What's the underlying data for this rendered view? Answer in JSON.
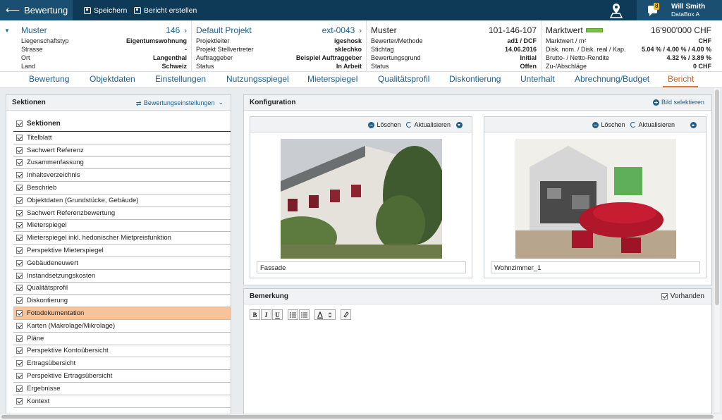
{
  "topbar": {
    "back_title": "Bewertung",
    "save_label": "Speichern",
    "report_label": "Bericht erstellen",
    "notification_count": "8",
    "user_name": "Will Smith",
    "user_sub": "DataBox A"
  },
  "info": {
    "col1": {
      "title": "Muster",
      "id": "146",
      "rows": [
        {
          "k": "Liegenschaftstyp",
          "v": "Eigentumswohnung"
        },
        {
          "k": "Strasse",
          "v": "-"
        },
        {
          "k": "Ort",
          "v": "Langenthal"
        },
        {
          "k": "Land",
          "v": "Schweiz"
        }
      ]
    },
    "col2": {
      "title": "Default Projekt",
      "id": "ext-0043",
      "rows": [
        {
          "k": "Projektleiter",
          "v": "igeshosk"
        },
        {
          "k": "Projekt Stellvertreter",
          "v": "sklechko"
        },
        {
          "k": "Auftraggeber",
          "v": "Beispiel Auftraggeber"
        },
        {
          "k": "Status",
          "v": "In Arbeit"
        }
      ]
    },
    "col3": {
      "title": "Muster",
      "id": "101-146-107",
      "rows": [
        {
          "k": "Bewerter/Methode",
          "v": "ad1 / DCF"
        },
        {
          "k": "Stichtag",
          "v": "14.06.2016"
        },
        {
          "k": "Bewertungsgrund",
          "v": "Initial"
        },
        {
          "k": "Status",
          "v": "Offen"
        }
      ]
    },
    "col4": {
      "title": "Marktwert",
      "id": "16'900'000 CHF",
      "rows": [
        {
          "k": "Marktwert / m²",
          "v": "CHF"
        },
        {
          "k": "Disk. nom. / Disk. real / Kap.",
          "v": "5.04 % / 4.00 % / 4.00 %"
        },
        {
          "k": "Brutto- / Netto-Rendite",
          "v": "4.32 % / 3.89 %"
        },
        {
          "k": "Zu-/Abschläge",
          "v": "0 CHF"
        }
      ]
    }
  },
  "tabs": [
    "Bewertung",
    "Objektdaten",
    "Einstellungen",
    "Nutzungsspiegel",
    "Mieterspiegel",
    "Qualitätsprofil",
    "Diskontierung",
    "Unterhalt",
    "Abrechnung/Budget",
    "Bericht"
  ],
  "sections": {
    "title": "Sektionen",
    "settings_label": "Bewertungseinstellungen",
    "header_label": "Sektionen",
    "items": [
      "Titelblatt",
      "Sachwert Referenz",
      "Zusammenfassung",
      "Inhaltsverzeichnis",
      "Beschrieb",
      "Objektdaten (Grundstücke, Gebäude)",
      "Sachwert Referenzbewertung",
      "Mieterspiegel",
      "Mieterspiegel inkl. hedonischer Mietpreisfunktion",
      "Perspektive Mieterspiegel",
      "Gebäudeneuwert",
      "Instandsetzungskosten",
      "Qualitätsprofil",
      "Diskontierung",
      "Fotodokumentation",
      "Karten (Makrolage/Mikrolage)",
      "Pläne",
      "Perspektive Kontoübersicht",
      "Ertragsübersicht",
      "Perspektive Ertragsübersicht",
      "Ergebnisse",
      "Kontext"
    ]
  },
  "config": {
    "title": "Konfiguration",
    "select_image_label": "Bild selektieren",
    "delete_label": "Löschen",
    "refresh_label": "Aktualisieren",
    "images": [
      {
        "caption": "Fassade"
      },
      {
        "caption": "Wohnzimmer_1"
      }
    ]
  },
  "remark": {
    "title": "Bemerkung",
    "present_label": "Vorhanden",
    "toolbar": {
      "bold": "B",
      "italic": "I",
      "underline": "U"
    }
  }
}
